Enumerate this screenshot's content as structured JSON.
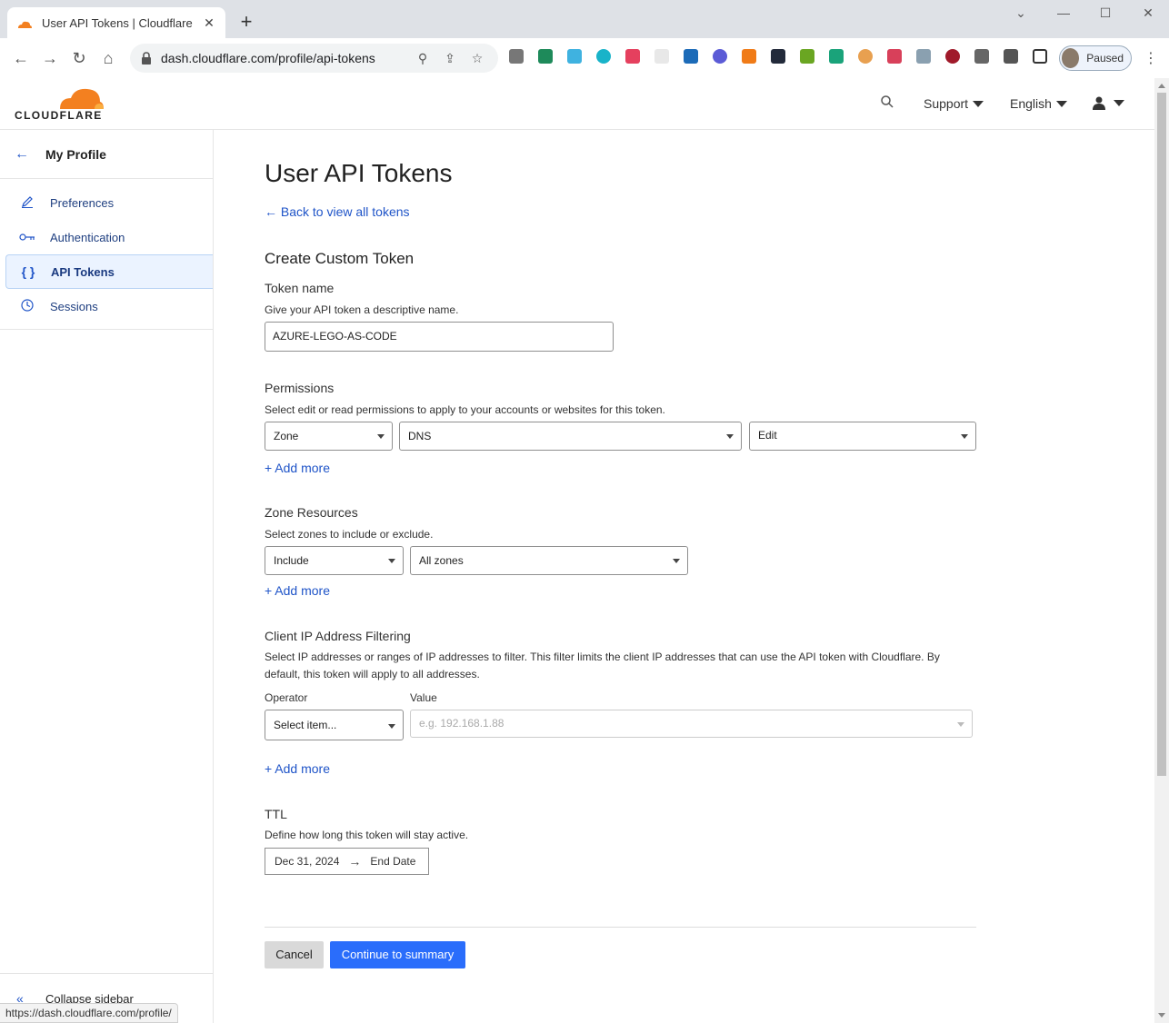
{
  "browser": {
    "tab_title": "User API Tokens | Cloudflare",
    "url": "dash.cloudflare.com/profile/api-tokens",
    "profile_label": "Paused",
    "status_url": "https://dash.cloudflare.com/profile/"
  },
  "header": {
    "logo_text": "CLOUDFLARE",
    "support_label": "Support",
    "language_label": "English"
  },
  "sidebar": {
    "back_label": "My Profile",
    "items": [
      {
        "label": "Preferences",
        "icon": "pencil-icon"
      },
      {
        "label": "Authentication",
        "icon": "key-icon"
      },
      {
        "label": "API Tokens",
        "icon": "braces-icon",
        "active": true
      },
      {
        "label": "Sessions",
        "icon": "clock-icon"
      }
    ],
    "collapse_label": "Collapse sidebar"
  },
  "main": {
    "title": "User API Tokens",
    "back_link": "Back to view all tokens",
    "form_title": "Create Custom Token",
    "token_name": {
      "label": "Token name",
      "help": "Give your API token a descriptive name.",
      "value": "AZURE-LEGO-AS-CODE"
    },
    "permissions": {
      "label": "Permissions",
      "help": "Select edit or read permissions to apply to your accounts or websites for this token.",
      "scope": "Zone",
      "resource": "DNS",
      "access": "Edit",
      "add_more": "Add more"
    },
    "zone_resources": {
      "label": "Zone Resources",
      "help": "Select zones to include or exclude.",
      "mode": "Include",
      "zones": "All zones",
      "add_more": "Add more"
    },
    "ip_filtering": {
      "label": "Client IP Address Filtering",
      "help": "Select IP addresses or ranges of IP addresses to filter. This filter limits the client IP addresses that can use the API token with Cloudflare. By default, this token will apply to all addresses.",
      "operator_label": "Operator",
      "value_label": "Value",
      "operator_value": "Select item...",
      "value_placeholder": "e.g. 192.168.1.88",
      "add_more": "Add more"
    },
    "ttl": {
      "label": "TTL",
      "help": "Define how long this token will stay active.",
      "start_date": "Dec 31, 2024",
      "end_date": "End Date"
    },
    "cancel_label": "Cancel",
    "continue_label": "Continue to summary"
  },
  "colors": {
    "accent": "#2a6dfb",
    "link": "#1f54c8",
    "brand_orange": "#f38020"
  }
}
